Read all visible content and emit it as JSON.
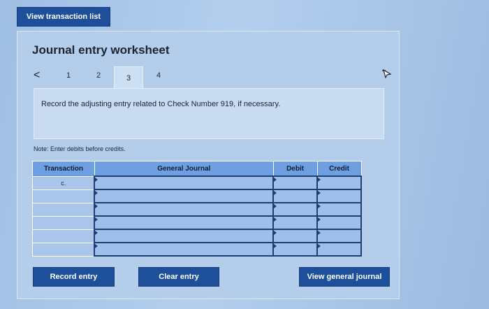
{
  "top_button_label": "View transaction list",
  "title": "Journal entry worksheet",
  "tabs": [
    {
      "label": "1",
      "active": false
    },
    {
      "label": "2",
      "active": false
    },
    {
      "label": "3",
      "active": true
    },
    {
      "label": "4",
      "active": false
    }
  ],
  "prev_icon": "<",
  "next_icon": "cursor-icon",
  "instruction": "Record the adjusting entry related to Check Number 919, if necessary.",
  "note": "Note: Enter debits before credits.",
  "table": {
    "headers": {
      "transaction": "Transaction",
      "general_journal": "General Journal",
      "debit": "Debit",
      "credit": "Credit"
    },
    "rows": [
      {
        "transaction": "c.",
        "account": "",
        "debit": "",
        "credit": ""
      },
      {
        "transaction": "",
        "account": "",
        "debit": "",
        "credit": ""
      },
      {
        "transaction": "",
        "account": "",
        "debit": "",
        "credit": ""
      },
      {
        "transaction": "",
        "account": "",
        "debit": "",
        "credit": ""
      },
      {
        "transaction": "",
        "account": "",
        "debit": "",
        "credit": ""
      },
      {
        "transaction": "",
        "account": "",
        "debit": "",
        "credit": ""
      }
    ]
  },
  "buttons": {
    "record": "Record entry",
    "clear": "Clear entry",
    "view_general_journal": "View general journal"
  },
  "colors": {
    "button_blue": "#1d4f9a",
    "header_blue": "#6e9fe1"
  }
}
